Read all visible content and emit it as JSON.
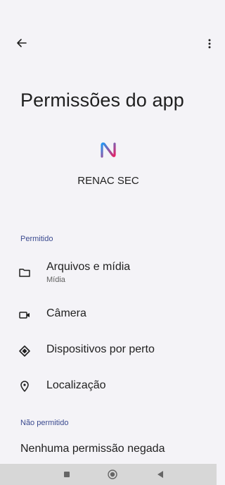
{
  "header": {
    "title": "Permissões do app"
  },
  "app": {
    "name": "RENAC SEC"
  },
  "sections": {
    "allowed_title": "Permitido",
    "denied_title": "Não permitido"
  },
  "permissions": [
    {
      "label": "Arquivos e mídia",
      "subtitle": "Mídia",
      "icon": "folder-icon"
    },
    {
      "label": "Câmera",
      "icon": "camera-icon"
    },
    {
      "label": "Dispositivos por perto",
      "icon": "nearby-devices-icon"
    },
    {
      "label": "Localização",
      "icon": "location-pin-icon"
    }
  ],
  "denied": {
    "empty_text": "Nenhuma permissão negada"
  },
  "navbar": {
    "buttons": [
      "recents-icon",
      "home-icon",
      "back-icon"
    ]
  },
  "colors": {
    "accent": "#3b4a8f",
    "logo_gradient_start": "#2196f3",
    "logo_gradient_end": "#e91e63"
  }
}
